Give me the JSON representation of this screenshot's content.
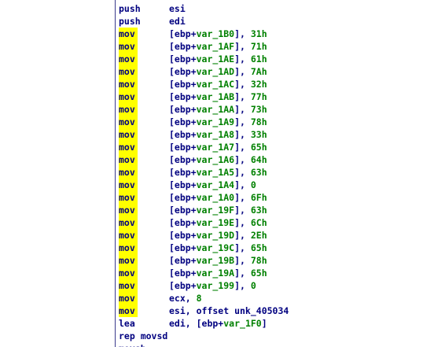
{
  "lines": [
    {
      "mnemonic": "push",
      "highlight": false,
      "operands": [
        {
          "t": "esi",
          "c": "reg"
        }
      ]
    },
    {
      "mnemonic": "push",
      "highlight": false,
      "operands": [
        {
          "t": "edi",
          "c": "reg"
        }
      ]
    },
    {
      "mnemonic": "mov",
      "highlight": true,
      "operands": [
        {
          "t": "[ebp+",
          "c": "punct"
        },
        {
          "t": "var_1B0",
          "c": "var"
        },
        {
          "t": "], ",
          "c": "punct"
        },
        {
          "t": "31h",
          "c": "num"
        }
      ]
    },
    {
      "mnemonic": "mov",
      "highlight": true,
      "operands": [
        {
          "t": "[ebp+",
          "c": "punct"
        },
        {
          "t": "var_1AF",
          "c": "var"
        },
        {
          "t": "], ",
          "c": "punct"
        },
        {
          "t": "71h",
          "c": "num"
        }
      ]
    },
    {
      "mnemonic": "mov",
      "highlight": true,
      "operands": [
        {
          "t": "[ebp+",
          "c": "punct"
        },
        {
          "t": "var_1AE",
          "c": "var"
        },
        {
          "t": "], ",
          "c": "punct"
        },
        {
          "t": "61h",
          "c": "num"
        }
      ]
    },
    {
      "mnemonic": "mov",
      "highlight": true,
      "operands": [
        {
          "t": "[ebp+",
          "c": "punct"
        },
        {
          "t": "var_1AD",
          "c": "var"
        },
        {
          "t": "], ",
          "c": "punct"
        },
        {
          "t": "7Ah",
          "c": "num"
        }
      ]
    },
    {
      "mnemonic": "mov",
      "highlight": true,
      "operands": [
        {
          "t": "[ebp+",
          "c": "punct"
        },
        {
          "t": "var_1AC",
          "c": "var"
        },
        {
          "t": "], ",
          "c": "punct"
        },
        {
          "t": "32h",
          "c": "num"
        }
      ]
    },
    {
      "mnemonic": "mov",
      "highlight": true,
      "operands": [
        {
          "t": "[ebp+",
          "c": "punct"
        },
        {
          "t": "var_1AB",
          "c": "var"
        },
        {
          "t": "], ",
          "c": "punct"
        },
        {
          "t": "77h",
          "c": "num"
        }
      ]
    },
    {
      "mnemonic": "mov",
      "highlight": true,
      "operands": [
        {
          "t": "[ebp+",
          "c": "punct"
        },
        {
          "t": "var_1AA",
          "c": "var"
        },
        {
          "t": "], ",
          "c": "punct"
        },
        {
          "t": "73h",
          "c": "num"
        }
      ]
    },
    {
      "mnemonic": "mov",
      "highlight": true,
      "operands": [
        {
          "t": "[ebp+",
          "c": "punct"
        },
        {
          "t": "var_1A9",
          "c": "var"
        },
        {
          "t": "], ",
          "c": "punct"
        },
        {
          "t": "78h",
          "c": "num"
        }
      ]
    },
    {
      "mnemonic": "mov",
      "highlight": true,
      "operands": [
        {
          "t": "[ebp+",
          "c": "punct"
        },
        {
          "t": "var_1A8",
          "c": "var"
        },
        {
          "t": "], ",
          "c": "punct"
        },
        {
          "t": "33h",
          "c": "num"
        }
      ]
    },
    {
      "mnemonic": "mov",
      "highlight": true,
      "operands": [
        {
          "t": "[ebp+",
          "c": "punct"
        },
        {
          "t": "var_1A7",
          "c": "var"
        },
        {
          "t": "], ",
          "c": "punct"
        },
        {
          "t": "65h",
          "c": "num"
        }
      ]
    },
    {
      "mnemonic": "mov",
      "highlight": true,
      "operands": [
        {
          "t": "[ebp+",
          "c": "punct"
        },
        {
          "t": "var_1A6",
          "c": "var"
        },
        {
          "t": "], ",
          "c": "punct"
        },
        {
          "t": "64h",
          "c": "num"
        }
      ]
    },
    {
      "mnemonic": "mov",
      "highlight": true,
      "operands": [
        {
          "t": "[ebp+",
          "c": "punct"
        },
        {
          "t": "var_1A5",
          "c": "var"
        },
        {
          "t": "], ",
          "c": "punct"
        },
        {
          "t": "63h",
          "c": "num"
        }
      ]
    },
    {
      "mnemonic": "mov",
      "highlight": true,
      "operands": [
        {
          "t": "[ebp+",
          "c": "punct"
        },
        {
          "t": "var_1A4",
          "c": "var"
        },
        {
          "t": "], ",
          "c": "punct"
        },
        {
          "t": "0",
          "c": "num"
        }
      ]
    },
    {
      "mnemonic": "mov",
      "highlight": true,
      "operands": [
        {
          "t": "[ebp+",
          "c": "punct"
        },
        {
          "t": "var_1A0",
          "c": "var"
        },
        {
          "t": "], ",
          "c": "punct"
        },
        {
          "t": "6Fh",
          "c": "num"
        }
      ]
    },
    {
      "mnemonic": "mov",
      "highlight": true,
      "operands": [
        {
          "t": "[ebp+",
          "c": "punct"
        },
        {
          "t": "var_19F",
          "c": "var"
        },
        {
          "t": "], ",
          "c": "punct"
        },
        {
          "t": "63h",
          "c": "num"
        }
      ]
    },
    {
      "mnemonic": "mov",
      "highlight": true,
      "operands": [
        {
          "t": "[ebp+",
          "c": "punct"
        },
        {
          "t": "var_19E",
          "c": "var"
        },
        {
          "t": "], ",
          "c": "punct"
        },
        {
          "t": "6Ch",
          "c": "num"
        }
      ]
    },
    {
      "mnemonic": "mov",
      "highlight": true,
      "operands": [
        {
          "t": "[ebp+",
          "c": "punct"
        },
        {
          "t": "var_19D",
          "c": "var"
        },
        {
          "t": "], ",
          "c": "punct"
        },
        {
          "t": "2Eh",
          "c": "num"
        }
      ]
    },
    {
      "mnemonic": "mov",
      "highlight": true,
      "operands": [
        {
          "t": "[ebp+",
          "c": "punct"
        },
        {
          "t": "var_19C",
          "c": "var"
        },
        {
          "t": "], ",
          "c": "punct"
        },
        {
          "t": "65h",
          "c": "num"
        }
      ]
    },
    {
      "mnemonic": "mov",
      "highlight": true,
      "operands": [
        {
          "t": "[ebp+",
          "c": "punct"
        },
        {
          "t": "var_19B",
          "c": "var"
        },
        {
          "t": "], ",
          "c": "punct"
        },
        {
          "t": "78h",
          "c": "num"
        }
      ]
    },
    {
      "mnemonic": "mov",
      "highlight": true,
      "operands": [
        {
          "t": "[ebp+",
          "c": "punct"
        },
        {
          "t": "var_19A",
          "c": "var"
        },
        {
          "t": "], ",
          "c": "punct"
        },
        {
          "t": "65h",
          "c": "num"
        }
      ]
    },
    {
      "mnemonic": "mov",
      "highlight": true,
      "operands": [
        {
          "t": "[ebp+",
          "c": "punct"
        },
        {
          "t": "var_199",
          "c": "var"
        },
        {
          "t": "], ",
          "c": "punct"
        },
        {
          "t": "0",
          "c": "num"
        }
      ]
    },
    {
      "mnemonic": "mov",
      "highlight": true,
      "operands": [
        {
          "t": "ecx, ",
          "c": "reg"
        },
        {
          "t": "8",
          "c": "num"
        }
      ]
    },
    {
      "mnemonic": "mov",
      "highlight": true,
      "operands": [
        {
          "t": "esi, offset unk_405034",
          "c": "reg"
        }
      ]
    },
    {
      "mnemonic": "lea",
      "highlight": false,
      "operands": [
        {
          "t": "edi, [ebp+",
          "c": "reg"
        },
        {
          "t": "var_1F0",
          "c": "var"
        },
        {
          "t": "]",
          "c": "punct"
        }
      ]
    },
    {
      "mnemonic": "rep movsd",
      "highlight": false,
      "operands": []
    },
    {
      "mnemonic": "movsb",
      "highlight": false,
      "operands": []
    }
  ],
  "colors": {
    "background": "#ffffff",
    "mnemonic": "#000080",
    "register": "#000080",
    "variable": "#008000",
    "immediate": "#008000",
    "highlight": "#ffff00",
    "gutter_rule": "#3a3a8c"
  }
}
